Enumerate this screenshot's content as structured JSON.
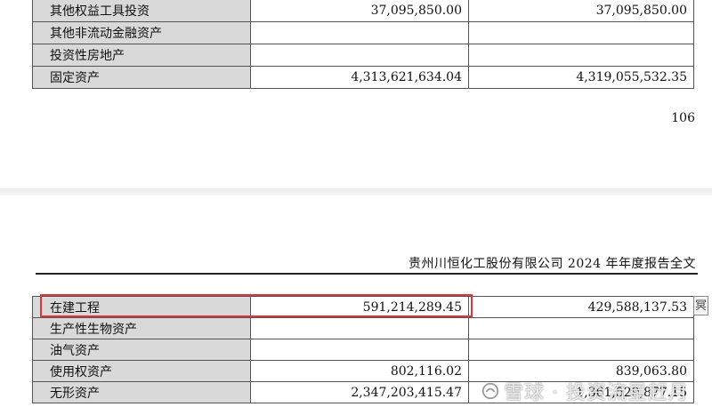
{
  "top_page": {
    "rows": [
      {
        "label": "其他权益工具投资",
        "current": "37,095,850.00",
        "previous": "37,095,850.00"
      },
      {
        "label": "其他非流动金融资产",
        "current": "",
        "previous": ""
      },
      {
        "label": "投资性房地产",
        "current": "",
        "previous": ""
      },
      {
        "label": "固定资产",
        "current": "4,313,621,634.04",
        "previous": "4,319,055,532.35"
      }
    ],
    "page_number": "106"
  },
  "bottom_page": {
    "header": "贵州川恒化工股份有限公司 2024 年年度报告全文",
    "rows": [
      {
        "label": "在建工程",
        "current": "591,214,289.45",
        "previous": "429,588,137.53"
      },
      {
        "label": "生产性生物资产",
        "current": "",
        "previous": ""
      },
      {
        "label": "油气资产",
        "current": "",
        "previous": ""
      },
      {
        "label": "使用权资产",
        "current": "802,116.02",
        "previous": "839,063.80"
      },
      {
        "label": "无形资产",
        "current": "2,347,203,415.47",
        "previous": "1,361,529,877.15"
      }
    ],
    "highlight_color": "#e0343a",
    "side_glyph": "冥"
  },
  "watermark": {
    "text": "雪球 · 投资流星赶月",
    "icon": "snowball-logo-icon"
  }
}
